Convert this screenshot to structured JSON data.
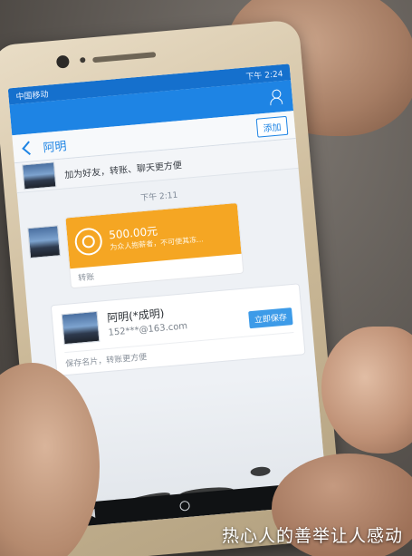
{
  "status_bar": {
    "left_text": "中国移动",
    "time": "下午 2:24"
  },
  "chat": {
    "contact_name": "阿明",
    "add_button": "添加",
    "add_friend_prompt": "加为好友，转账、聊天更方便",
    "timestamp": "下午 2:11"
  },
  "transfer_message": {
    "amount": "500.00元",
    "note": "为众人抱薪者，不可使其冻...",
    "label": "转账"
  },
  "contact_card": {
    "name": "阿明(*成明)",
    "email": "152***@163.com",
    "button": "立即保存",
    "footer": "保存名片，转账更方便"
  },
  "caption": "热心人的善举让人感动",
  "colors": {
    "header_blue": "#1e84e4",
    "transfer_orange": "#f5a623"
  }
}
